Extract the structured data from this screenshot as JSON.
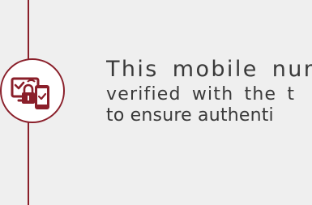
{
  "description_lines": [
    "This mobile number",
    "verified with the t",
    "to ensure authenti"
  ],
  "icon": {
    "name": "verified-device-lock-icon"
  },
  "colors": {
    "background": "#efefef",
    "accent": "#8a1f2a",
    "text": "#3a3a3a"
  }
}
